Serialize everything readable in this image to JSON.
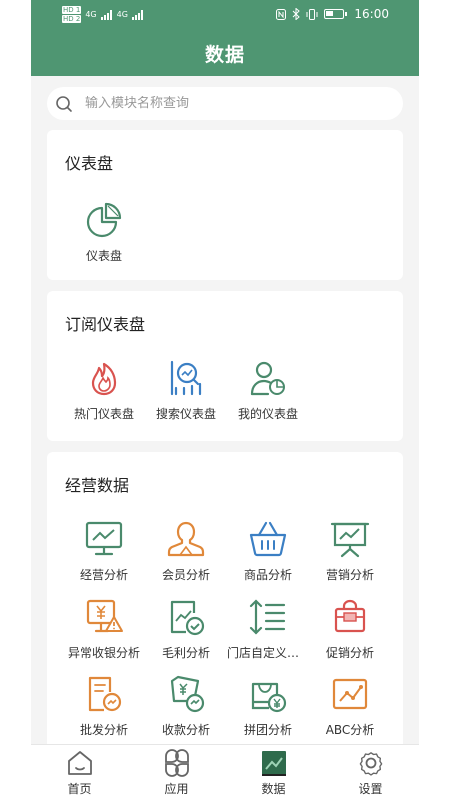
{
  "status_bar": {
    "carrier_1": "HD 1",
    "carrier_2": "HD 2",
    "net_1": "4G",
    "net_2": "4G",
    "time": "16:00"
  },
  "header": {
    "title": "数据"
  },
  "search": {
    "placeholder": "输入模块名称查询",
    "value": ""
  },
  "sections": {
    "dashboard": {
      "title": "仪表盘",
      "items": [
        {
          "label": "仪表盘",
          "icon": "pie-chart-icon"
        }
      ]
    },
    "subscribed": {
      "title": "订阅仪表盘",
      "items": [
        {
          "label": "热门仪表盘",
          "icon": "flame-icon"
        },
        {
          "label": "搜索仪表盘",
          "icon": "search-chart-icon"
        },
        {
          "label": "我的仪表盘",
          "icon": "user-chart-icon"
        }
      ]
    },
    "business": {
      "title": "经营数据",
      "items": [
        {
          "label": "经营分析",
          "icon": "monitor-chart-icon"
        },
        {
          "label": "会员分析",
          "icon": "member-icon"
        },
        {
          "label": "商品分析",
          "icon": "basket-icon"
        },
        {
          "label": "营销分析",
          "icon": "presentation-icon"
        },
        {
          "label": "异常收银分析",
          "icon": "cash-warning-icon"
        },
        {
          "label": "毛利分析",
          "icon": "profit-check-icon"
        },
        {
          "label": "门店自定义分析",
          "icon": "sort-list-icon"
        },
        {
          "label": "促销分析",
          "icon": "promotion-bag-icon"
        },
        {
          "label": "批发分析",
          "icon": "wholesale-doc-icon"
        },
        {
          "label": "收款分析",
          "icon": "payment-receipt-icon"
        },
        {
          "label": "拼团分析",
          "icon": "group-buy-bag-icon"
        },
        {
          "label": "ABC分析",
          "icon": "abc-chart-icon"
        }
      ]
    }
  },
  "tabbar": {
    "items": [
      {
        "label": "首页",
        "icon": "home-icon"
      },
      {
        "label": "应用",
        "icon": "apps-icon"
      },
      {
        "label": "数据",
        "icon": "data-chart-icon",
        "active": true
      },
      {
        "label": "设置",
        "icon": "gear-icon"
      }
    ]
  },
  "colors": {
    "primary": "#4f9672",
    "green_icon": "#4a8a6c",
    "orange_icon": "#e0883a",
    "blue_icon": "#3b7fc4",
    "red_icon": "#d9534f"
  }
}
